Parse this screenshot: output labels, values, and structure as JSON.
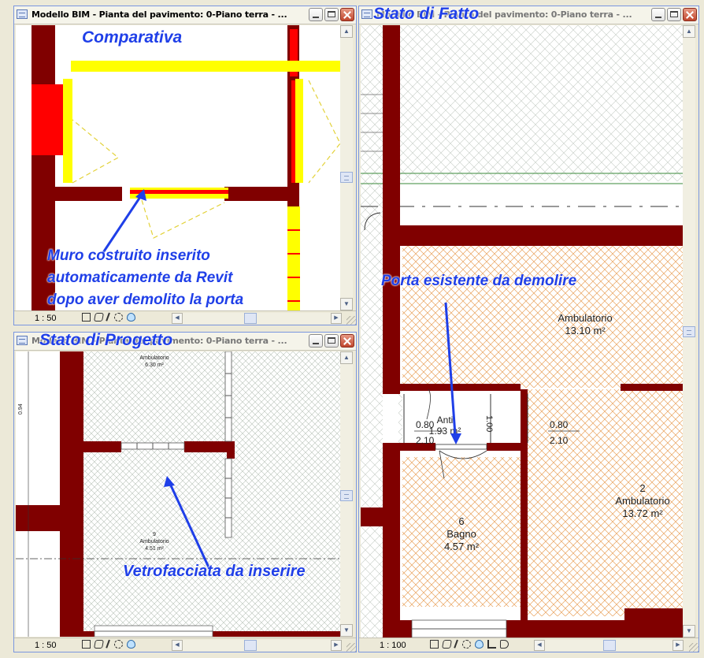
{
  "windows": {
    "top_left": {
      "title": "Modello BIM - Pianta del pavimento: 0-Piano terra - ...",
      "scale": "1 : 50",
      "heading": "Comparativa",
      "annotation_lines": [
        "Muro costruito inserito",
        "automaticamente da Revit",
        "dopo aver demolito la porta"
      ]
    },
    "bottom_left": {
      "title": "Modello BIM - Pianta del pavimento: 0-Piano terra - ...",
      "scale": "1 : 50",
      "heading": "Stato di Progetto",
      "annotation": "Vetrofacciata da inserire",
      "room_top_name": "Ambulatorio",
      "room_top_area": "6.30 m²",
      "room_mid_number": "9",
      "room_mid_name": "Ambulatorio",
      "room_mid_area": "4.51 m²",
      "dim_vertical": "0.94"
    },
    "right": {
      "title": "Modello BIM - Pianta del pavimento: 0-Piano terra - ...",
      "scale": "1 : 100",
      "heading": "Stato di Fatto",
      "annotation": "Porta esistente da demolire",
      "rooms": [
        {
          "number": "",
          "name": "Ambulatorio",
          "area": "13.10 m²"
        },
        {
          "number": "6",
          "name": "Bagno",
          "area": "4.57 m²"
        },
        {
          "number": "2",
          "name": "Ambulatorio",
          "area": "13.72 m²"
        },
        {
          "number": "",
          "name": "Anti",
          "area": "1.93 m²"
        }
      ],
      "door_tag_left": {
        "width": "0.80",
        "height": "2.10"
      },
      "door_tag_right": {
        "width": "0.80",
        "height": "2.10"
      },
      "door_dim": "1.00"
    }
  },
  "colors": {
    "wall": "#800000",
    "new": "#ffff00",
    "demolished": "#ff0000",
    "annotation": "#1f3fe8",
    "hatch_orange": "#e9a25c"
  },
  "icons": [
    "detail-level-icon",
    "visual-style-icon",
    "sun-path-icon",
    "shadows-icon",
    "reveal-hidden-icon",
    "crop-region-icon",
    "temporary-hide-icon"
  ]
}
